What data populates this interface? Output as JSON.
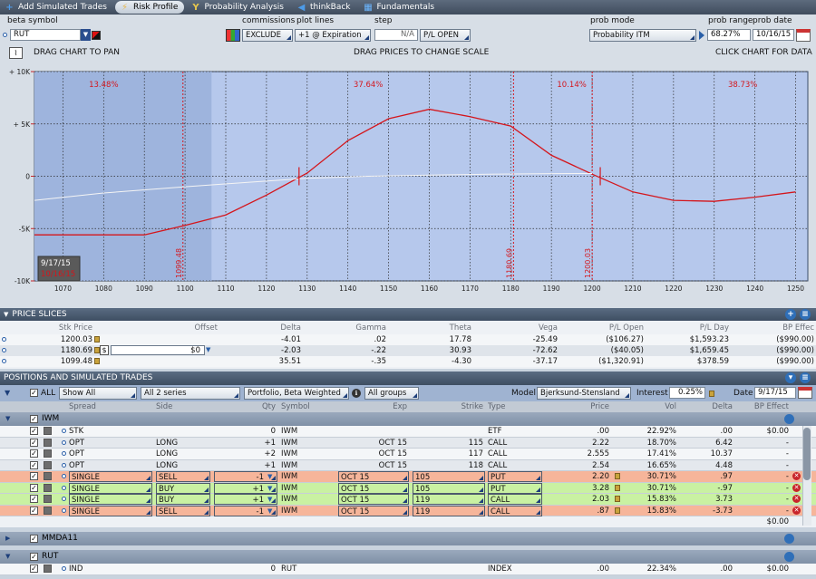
{
  "tabs": [
    {
      "label": "Add Simulated Trades",
      "icon": "plus-icon",
      "active": false
    },
    {
      "label": "Risk Profile",
      "icon": "risk-profile-icon",
      "active": true
    },
    {
      "label": "Probability Analysis",
      "icon": "probability-icon",
      "active": false
    },
    {
      "label": "thinkBack",
      "icon": "thinkback-icon",
      "active": false
    },
    {
      "label": "Fundamentals",
      "icon": "fundamentals-icon",
      "active": false
    }
  ],
  "controls": {
    "beta_symbol_label": "beta symbol",
    "beta_symbol_value": "RUT",
    "commissions_label": "commissions",
    "commissions_value": "EXCLUDE",
    "plot_lines_label": "plot lines",
    "plot_lines_value": "+1 @ Expiration",
    "step_label": "step",
    "step_value": "N/A",
    "step_mode": "P/L OPEN",
    "prob_mode_label": "prob mode",
    "prob_mode_value": "Probability ITM",
    "prob_range_label": "prob range",
    "prob_range_value": "68.27%",
    "prob_date_label": "prob date",
    "prob_date_value": "10/16/15"
  },
  "hints": {
    "pan": "DRAG CHART TO PAN",
    "scale": "DRAG PRICES TO CHANGE SCALE",
    "data": "CLICK CHART FOR DATA"
  },
  "chart_data": {
    "type": "line",
    "x_ticks": [
      1070,
      1080,
      1090,
      1100,
      1110,
      1120,
      1130,
      1140,
      1150,
      1160,
      1170,
      1180,
      1190,
      1200,
      1210,
      1220,
      1230,
      1240,
      1250
    ],
    "y_ticks": [
      "+ 10K",
      "+ 5K",
      "0",
      "-5K",
      "-10K"
    ],
    "y_values": [
      10000,
      5000,
      0,
      -5000,
      -10000
    ],
    "xlim": [
      1063,
      1253
    ],
    "ylim": [
      -10000,
      10000
    ],
    "probability_labels": [
      "13.48%",
      "37.64%",
      "10.14%",
      "38.73%"
    ],
    "probability_label_x": [
      1080,
      1145,
      1195,
      1237
    ],
    "vertical_lines": [
      {
        "x": 1099.48,
        "label": "1099.48"
      },
      {
        "x": 1180.69,
        "label": "1180.69"
      },
      {
        "x": 1200.03,
        "label": "1200.03"
      }
    ],
    "prob_range": [
      1063,
      1106.5
    ],
    "date_box": {
      "date1": "9/17/15",
      "date2": "10/16/15"
    },
    "series": [
      {
        "color": "#d4161c",
        "x": [
          1063,
          1090,
          1100,
          1110,
          1120,
          1130,
          1140,
          1150,
          1160,
          1170,
          1180,
          1190,
          1200,
          1210,
          1220,
          1230,
          1240,
          1250
        ],
        "y": [
          -5600,
          -5600,
          -4700,
          -3700,
          -1800,
          300,
          3400,
          5500,
          6400,
          5700,
          4800,
          2000,
          200,
          -1500,
          -2300,
          -2400,
          -2000,
          -1500
        ]
      },
      {
        "color": "#f4f4f4",
        "x": [
          1063,
          1080,
          1100,
          1115,
          1130,
          1145,
          1160,
          1175,
          1190,
          1200
        ],
        "y": [
          -2300,
          -1600,
          -1000,
          -600,
          -200,
          0,
          100,
          200,
          250,
          260
        ]
      }
    ],
    "markers_x": [
      1128,
      1202
    ]
  },
  "price_slices": {
    "title": "PRICE SLICES",
    "columns": [
      "Stk Price",
      "Offset",
      "Delta",
      "Gamma",
      "Theta",
      "Vega",
      "P/L Open",
      "P/L Day",
      "BP Effec"
    ],
    "rows": [
      [
        "1200.03",
        "",
        "-4.01",
        ".02",
        "17.78",
        "-25.49",
        "($106.27)",
        "$1,593.23",
        "($990.00)"
      ],
      [
        "1180.69",
        "$0",
        "-2.03",
        "-.22",
        "30.93",
        "-72.62",
        "($40.05)",
        "$1,659.45",
        "($990.00)"
      ],
      [
        "1099.48",
        "",
        "35.51",
        "-.35",
        "-4.30",
        "-37.17",
        "($1,320.91)",
        "$378.59",
        "($990.00)"
      ]
    ]
  },
  "positions": {
    "title": "POSITIONS AND SIMULATED TRADES",
    "filters": {
      "all_label": "ALL",
      "show": "Show All",
      "series": "All 2 series",
      "portfolio": "Portfolio, Beta Weighted",
      "groups": "All groups",
      "model_label": "Model",
      "model_value": "Bjerksund-Stensland",
      "interest_label": "Interest",
      "interest_value": "0.25%",
      "date_label": "Date",
      "date_value": "9/17/15"
    },
    "columns": [
      "Spread",
      "Side",
      "Qty",
      "Symbol",
      "Exp",
      "Strike",
      "Type",
      "Price",
      "Vol",
      "Delta",
      "BP Effect"
    ],
    "groups": [
      {
        "name": "IWM",
        "rows": [
          {
            "spread": "STK",
            "side": "",
            "qty": "0",
            "symbol": "IWM",
            "exp": "",
            "strike": "",
            "type": "ETF",
            "price": ".00",
            "vol": "22.92%",
            "delta": ".00",
            "bp": "$0.00",
            "sim": ""
          },
          {
            "spread": "OPT",
            "side": "LONG",
            "qty": "+1",
            "symbol": "IWM",
            "exp": "OCT 15",
            "strike": "115",
            "type": "CALL",
            "price": "2.22",
            "vol": "18.70%",
            "delta": "6.42",
            "bp": "-",
            "sim": ""
          },
          {
            "spread": "OPT",
            "side": "LONG",
            "qty": "+2",
            "symbol": "IWM",
            "exp": "OCT 15",
            "strike": "117",
            "type": "CALL",
            "price": "2.555",
            "vol": "17.41%",
            "delta": "10.37",
            "bp": "-",
            "sim": ""
          },
          {
            "spread": "OPT",
            "side": "LONG",
            "qty": "+1",
            "symbol": "IWM",
            "exp": "OCT 15",
            "strike": "118",
            "type": "CALL",
            "price": "2.54",
            "vol": "16.65%",
            "delta": "4.48",
            "bp": "-",
            "sim": ""
          },
          {
            "spread": "SINGLE",
            "side": "SELL",
            "qty": "-1",
            "symbol": "IWM",
            "exp": "OCT 15",
            "strike": "105",
            "type": "PUT",
            "price": "2.20",
            "vol": "30.71%",
            "delta": ".97",
            "bp": "-",
            "sim": "sell"
          },
          {
            "spread": "SINGLE",
            "side": "BUY",
            "qty": "+1",
            "symbol": "IWM",
            "exp": "OCT 15",
            "strike": "105",
            "type": "PUT",
            "price": "3.28",
            "vol": "30.71%",
            "delta": "-.97",
            "bp": "-",
            "sim": "buy"
          },
          {
            "spread": "SINGLE",
            "side": "BUY",
            "qty": "+1",
            "symbol": "IWM",
            "exp": "OCT 15",
            "strike": "119",
            "type": "CALL",
            "price": "2.03",
            "vol": "15.83%",
            "delta": "3.73",
            "bp": "-",
            "sim": "buy"
          },
          {
            "spread": "SINGLE",
            "side": "SELL",
            "qty": "-1",
            "symbol": "IWM",
            "exp": "OCT 15",
            "strike": "119",
            "type": "CALL",
            "price": ".87",
            "vol": "15.83%",
            "delta": "-3.73",
            "bp": "-",
            "sim": "sell"
          }
        ],
        "total_bp": "$0.00"
      },
      {
        "name": "MMDA11",
        "rows": []
      },
      {
        "name": "RUT",
        "rows": [
          {
            "spread": "IND",
            "side": "",
            "qty": "0",
            "symbol": "RUT",
            "exp": "",
            "strike": "",
            "type": "INDEX",
            "price": ".00",
            "vol": "22.34%",
            "delta": ".00",
            "bp": "$0.00",
            "sim": ""
          }
        ]
      }
    ]
  },
  "colors": {
    "chart_bg": "#b6c8ec",
    "prob_range_bg": "#9eb4dd",
    "pl_line": "#d4161c",
    "sell_row": "#f6b59a",
    "buy_row": "#c9f1a2"
  }
}
